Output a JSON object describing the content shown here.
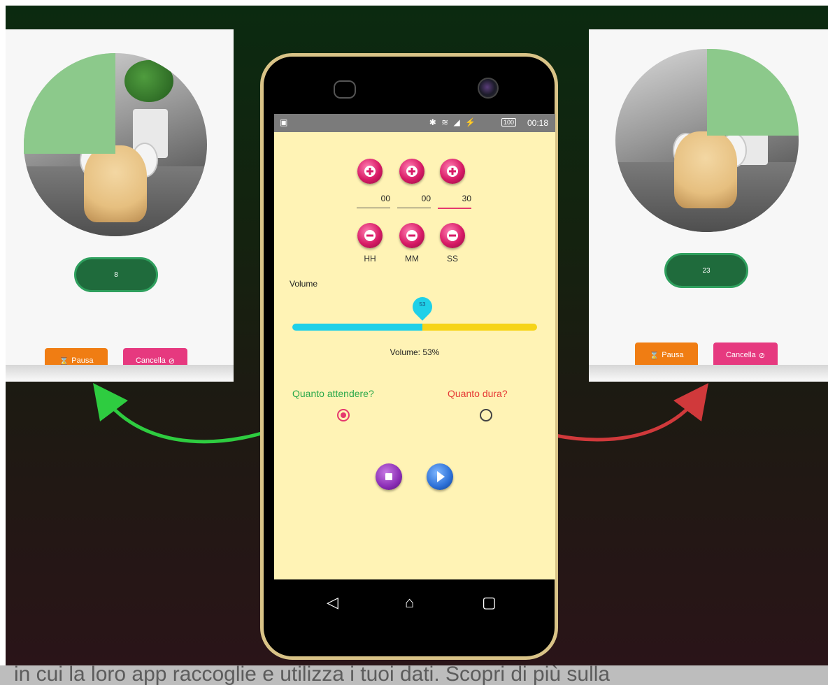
{
  "left_card": {
    "counter": "8",
    "pause_label": "Pausa",
    "cancel_label": "Cancella"
  },
  "right_card": {
    "counter": "23",
    "pause_label": "Pausa",
    "cancel_label": "Cancella"
  },
  "statusbar": {
    "time": "00:18",
    "battery": "100"
  },
  "timer": {
    "hours": "00",
    "minutes": "00",
    "seconds": "30",
    "units": {
      "h": "HH",
      "m": "MM",
      "s": "SS"
    }
  },
  "volume": {
    "label": "Volume",
    "value": 53,
    "value_text": "53",
    "status": "Volume: 53%"
  },
  "modes": {
    "wait_label": "Quanto attendere?",
    "duration_label": "Quanto dura?",
    "selected": "wait"
  },
  "colors": {
    "accent_pink": "#e5386e",
    "wait_green": "#2aa84a",
    "duration_red": "#e53935",
    "screen_bg": "#fff3b5"
  },
  "caption": "in cui la loro app raccoglie e utilizza i tuoi dati. Scopri di più sulla"
}
